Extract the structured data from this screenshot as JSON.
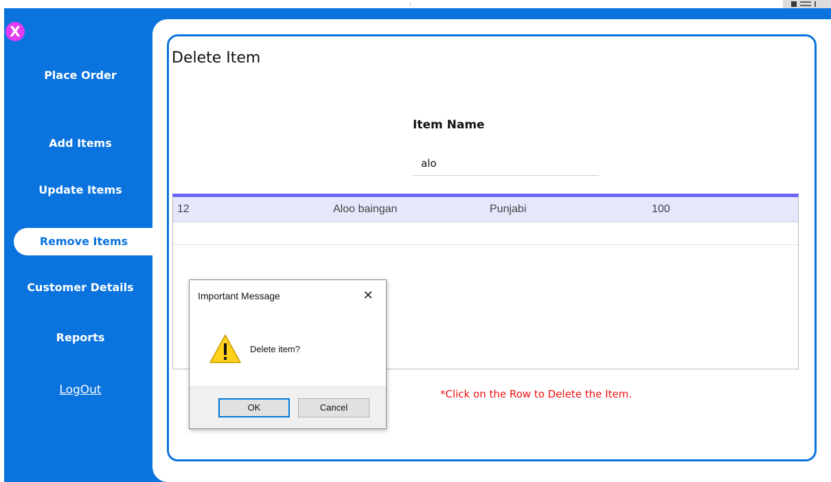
{
  "window": {
    "close_symbol": "X"
  },
  "sidebar": {
    "items": [
      {
        "label": "Place Order",
        "active": false
      },
      {
        "label": "Add Items",
        "active": false
      },
      {
        "label": "Update Items",
        "active": false
      },
      {
        "label": "Remove Items",
        "active": true
      },
      {
        "label": "Customer Details",
        "active": false
      },
      {
        "label": "Reports",
        "active": false
      }
    ],
    "logout_label": "LogOut"
  },
  "main": {
    "title": "Delete Item",
    "item_name_label": "Item Name",
    "item_name_value": "alo",
    "table": {
      "rows": [
        [
          "12",
          "Aloo baingan",
          "Punjabi",
          "100"
        ]
      ]
    },
    "hint": "*Click on the Row to Delete the Item."
  },
  "dialog": {
    "title": "Important Message",
    "close_symbol": "✕",
    "icon": "warning-icon",
    "message": "Delete item?",
    "ok_label": "OK",
    "cancel_label": "Cancel"
  },
  "colors": {
    "sidebar_bg": "#0a73de",
    "close_button": "#e23cf3",
    "table_header_line": "#6a63f5",
    "selected_row": "#e6e7fb",
    "hint_text": "#ee1111"
  }
}
